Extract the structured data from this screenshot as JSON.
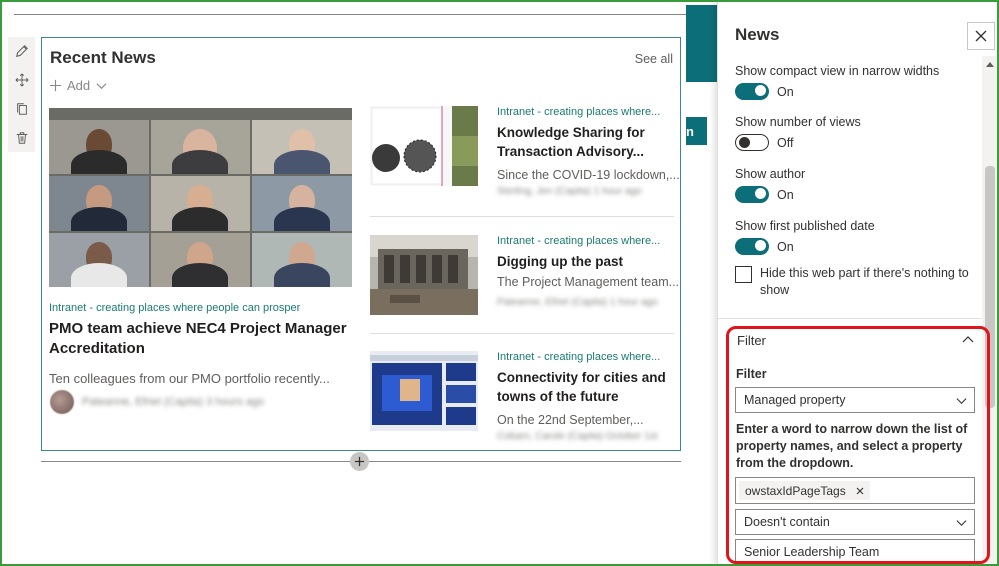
{
  "webpart": {
    "title": "Recent News",
    "see_all": "See all",
    "add_label": "Add"
  },
  "hero": {
    "tag": "Intranet - creating places where people can prosper",
    "title": "PMO team achieve NEC4 Project Manager Accreditation",
    "description": "Ten colleagues from our PMO portfolio recently...",
    "author_blurred": "Pateanne, Efriet (Capita)  3 hours ago"
  },
  "news": [
    {
      "tag": "Intranet - creating places where...",
      "title": "Knowledge Sharing for Transaction Advisory...",
      "description": "Since the COVID-19 lockdown,...",
      "meta_blurred": "Sterling, Jen (Capita)  1 hour ago"
    },
    {
      "tag": "Intranet - creating places where...",
      "title": "Digging up the past",
      "description": "The Project Management team...",
      "meta_blurred": "Pateanne, Efriet (Capita)  1 hour ago"
    },
    {
      "tag": "Intranet - creating places where...",
      "title": "Connectivity for cities and towns of the future",
      "description": "On the 22nd September,...",
      "meta_blurred": "Cobarn, Carole (Capita)  October 1st"
    }
  ],
  "background": {
    "button_fragment": "n"
  },
  "pane": {
    "title": "News",
    "toggles": [
      {
        "label": "Show compact view in narrow widths",
        "state": "On"
      },
      {
        "label": "Show number of views",
        "state": "Off"
      },
      {
        "label": "Show author",
        "state": "On"
      },
      {
        "label": "Show first published date",
        "state": "On"
      }
    ],
    "hide_checkbox_label": "Hide this web part if there's nothing to show",
    "filter_section_title": "Filter",
    "filter_label": "Filter",
    "filter_value": "Managed property",
    "help_text": "Enter a word to narrow down the list of property names, and select a property from the dropdown.",
    "property_chip": "owstaxIdPageTags",
    "operator_value": "Doesn't contain",
    "value_input": "Senior Leadership Team"
  },
  "colors": {
    "accent": "#0c6e79",
    "tag_text": "#1a7a72",
    "highlight": "#e0151b",
    "frame": "#3a9b3a"
  }
}
